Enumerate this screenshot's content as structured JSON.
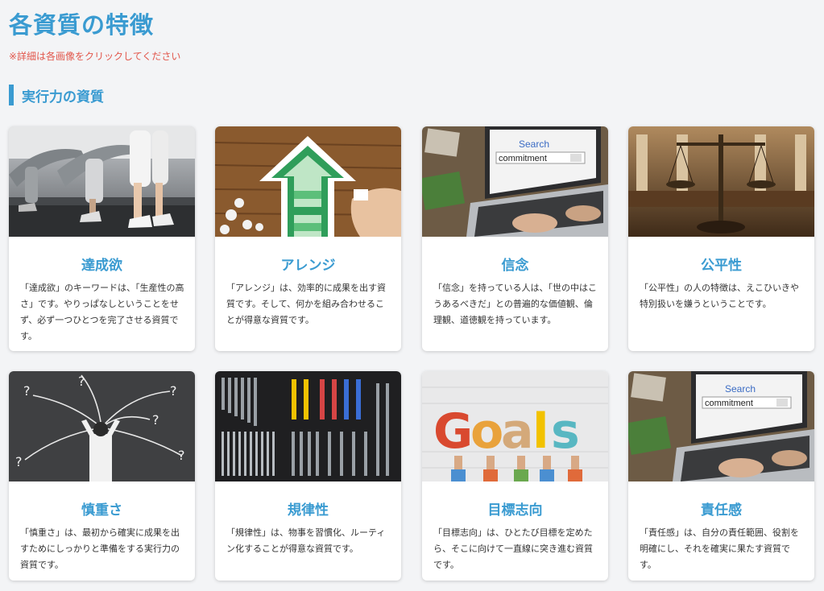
{
  "page": {
    "title": "各資質の特徴",
    "note": "※詳細は各画像をクリックしてください",
    "section_title": "実行力の資質"
  },
  "colors": {
    "accent": "#3a9bd1",
    "note": "#e2574c"
  },
  "cards": [
    {
      "name": "達成欲",
      "desc": "「達成欲」のキーワードは、「生産性の高さ」です。やりっぱなしということをせず、必ず一つひとつを完了させる資質です。",
      "image": "treadmill-runners-photo"
    },
    {
      "name": "アレンジ",
      "desc": "「アレンジ」は、効率的に成果を出す資質です。そして、何かを組み合わせることが得意な資質です。",
      "image": "puzzle-arrow-photo"
    },
    {
      "name": "信念",
      "desc": "「信念」を持っている人は、「世の中はこうあるべきだ」との普遍的な価値観、倫理観、道徳観を持っています。",
      "image": "laptop-commitment-search-photo",
      "search_label": "Search",
      "search_query": "commitment"
    },
    {
      "name": "公平性",
      "desc": "「公平性」の人の特徴は、えこひいきや特別扱いを嫌うということです。",
      "image": "justice-scales-photo"
    },
    {
      "name": "慎重さ",
      "desc": "「慎重さ」は、最初から確実に成果を出すためにしっかりと準備をする実行力の資質です。",
      "image": "thinking-man-question-marks-photo"
    },
    {
      "name": "規律性",
      "desc": "「規律性」は、物事を習慣化、ルーティン化することが得意な資質です。",
      "image": "organized-tool-wall-photo"
    },
    {
      "name": "目標志向",
      "desc": "「目標志向」は、ひとたび目標を定めたら、そこに向けて一直線に突き進む資質です。",
      "image": "goals-letters-photo",
      "goals_letters": [
        "G",
        "o",
        "a",
        "l",
        "s"
      ]
    },
    {
      "name": "責任感",
      "desc": "「責任感」は、自分の責任範囲、役割を明確にし、それを確実に果たす資質です。",
      "image": "laptop-commitment-search-photo",
      "search_label": "Search",
      "search_query": "commitment"
    }
  ]
}
